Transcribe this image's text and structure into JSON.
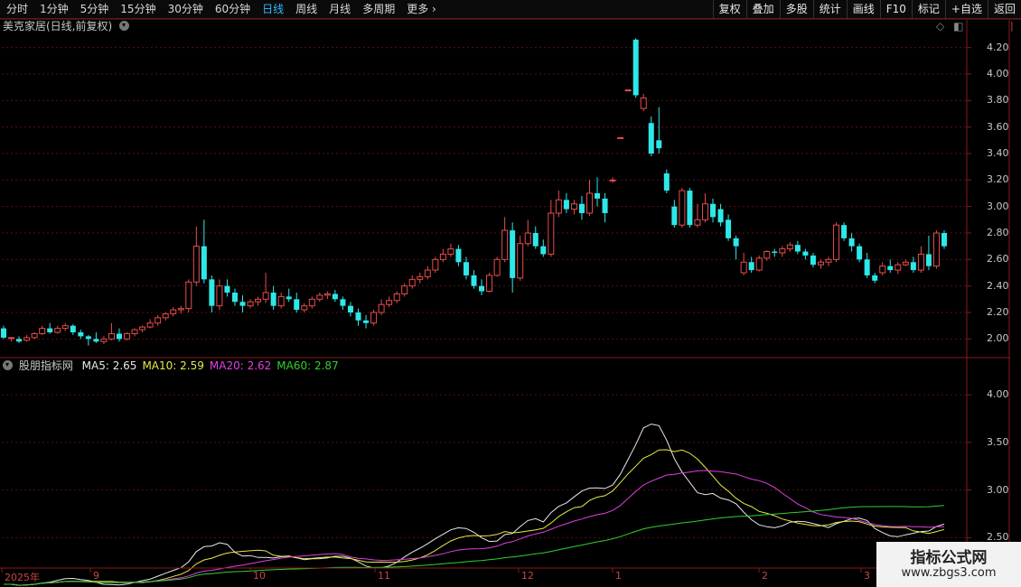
{
  "toolbar": {
    "periods": [
      "分时",
      "1分钟",
      "5分钟",
      "15分钟",
      "30分钟",
      "60分钟",
      "日线",
      "周线",
      "月线",
      "多周期",
      "更多"
    ],
    "active_period": "日线",
    "tools": [
      "复权",
      "叠加",
      "多股",
      "统计",
      "画线",
      "F10",
      "标记",
      "+自选",
      "返回"
    ]
  },
  "main_panel": {
    "title": "美克家居(日线,前复权)"
  },
  "indicator_panel": {
    "name": "股朋指标网",
    "items": [
      {
        "label": "MA5: 2.65",
        "color": "#e8e8e8"
      },
      {
        "label": "MA10: 2.59",
        "color": "#e8e848"
      },
      {
        "label": "MA20: 2.62",
        "color": "#e040e0"
      },
      {
        "label": "MA60: 2.87",
        "color": "#30d030"
      }
    ]
  },
  "price_axis": [
    "4.20",
    "4.00",
    "3.80",
    "3.60",
    "3.40",
    "3.20",
    "3.00",
    "2.80",
    "2.60",
    "2.40",
    "2.20",
    "2.00"
  ],
  "indicator_axis": [
    "4.00",
    "3.50",
    "3.00",
    "2.50"
  ],
  "date_axis": [
    "2025年",
    "9",
    "10",
    "11",
    "12",
    "1",
    "2",
    "3"
  ],
  "watermark": {
    "line1": "指标公式网",
    "line2": "www.zbgs3.com"
  },
  "colors": {
    "up": "#e84c4c",
    "down": "#2ee8e8",
    "grid": "#5a1010",
    "axis": "#8a1a1a"
  },
  "chart_data": {
    "type": "candlestick",
    "title": "美克家居(日线,前复权)",
    "ylim": [
      1.9,
      4.3
    ],
    "x_start": "2025年",
    "candles": [
      [
        2.08,
        2.1,
        2.01,
        2.0
      ],
      [
        2.01,
        2.0,
        2.01,
        1.98
      ],
      [
        2.0,
        2.02,
        1.98,
        1.97
      ],
      [
        1.99,
        2.03,
        2.01,
        1.98
      ],
      [
        2.01,
        2.05,
        2.04,
        2.0
      ],
      [
        2.04,
        2.1,
        2.08,
        2.03
      ],
      [
        2.08,
        2.12,
        2.05,
        2.04
      ],
      [
        2.05,
        2.1,
        2.08,
        2.04
      ],
      [
        2.08,
        2.12,
        2.1,
        2.06
      ],
      [
        2.1,
        2.11,
        2.05,
        2.03
      ],
      [
        2.05,
        2.07,
        2.02,
        2.0
      ],
      [
        2.02,
        2.03,
        2.0,
        1.95
      ],
      [
        2.0,
        2.05,
        1.98,
        1.97
      ],
      [
        1.98,
        2.02,
        2.0,
        1.96
      ],
      [
        2.0,
        2.12,
        2.04,
        1.99
      ],
      [
        2.04,
        2.08,
        2.0,
        1.98
      ],
      [
        2.0,
        2.05,
        2.04,
        1.99
      ],
      [
        2.04,
        2.08,
        2.07,
        2.02
      ],
      [
        2.07,
        2.1,
        2.09,
        2.05
      ],
      [
        2.09,
        2.15,
        2.12,
        2.08
      ],
      [
        2.12,
        2.18,
        2.16,
        2.1
      ],
      [
        2.16,
        2.2,
        2.19,
        2.14
      ],
      [
        2.19,
        2.24,
        2.22,
        2.17
      ],
      [
        2.22,
        2.25,
        2.23,
        2.19
      ],
      [
        2.23,
        2.45,
        2.43,
        2.2
      ],
      [
        2.43,
        2.85,
        2.7,
        2.4
      ],
      [
        2.7,
        2.9,
        2.45,
        2.42
      ],
      [
        2.45,
        2.48,
        2.25,
        2.2
      ],
      [
        2.25,
        2.45,
        2.4,
        2.22
      ],
      [
        2.4,
        2.45,
        2.35,
        2.32
      ],
      [
        2.35,
        2.38,
        2.28,
        2.25
      ],
      [
        2.28,
        2.33,
        2.25,
        2.2
      ],
      [
        2.25,
        2.3,
        2.28,
        2.23
      ],
      [
        2.28,
        2.32,
        2.3,
        2.25
      ],
      [
        2.3,
        2.5,
        2.35,
        2.27
      ],
      [
        2.35,
        2.4,
        2.25,
        2.22
      ],
      [
        2.25,
        2.35,
        2.32,
        2.23
      ],
      [
        2.32,
        2.38,
        2.3,
        2.28
      ],
      [
        2.3,
        2.35,
        2.22,
        2.2
      ],
      [
        2.22,
        2.27,
        2.25,
        2.2
      ],
      [
        2.25,
        2.32,
        2.3,
        2.23
      ],
      [
        2.3,
        2.35,
        2.33,
        2.28
      ],
      [
        2.33,
        2.36,
        2.34,
        2.3
      ],
      [
        2.34,
        2.37,
        2.3,
        2.28
      ],
      [
        2.3,
        2.32,
        2.25,
        2.22
      ],
      [
        2.25,
        2.28,
        2.2,
        2.17
      ],
      [
        2.2,
        2.23,
        2.14,
        2.1
      ],
      [
        2.14,
        2.18,
        2.12,
        2.08
      ],
      [
        2.12,
        2.22,
        2.2,
        2.1
      ],
      [
        2.2,
        2.3,
        2.26,
        2.18
      ],
      [
        2.26,
        2.32,
        2.29,
        2.24
      ],
      [
        2.29,
        2.36,
        2.34,
        2.27
      ],
      [
        2.34,
        2.42,
        2.4,
        2.32
      ],
      [
        2.4,
        2.48,
        2.45,
        2.38
      ],
      [
        2.45,
        2.5,
        2.47,
        2.42
      ],
      [
        2.47,
        2.55,
        2.52,
        2.45
      ],
      [
        2.52,
        2.62,
        2.6,
        2.5
      ],
      [
        2.6,
        2.68,
        2.64,
        2.58
      ],
      [
        2.64,
        2.72,
        2.68,
        2.62
      ],
      [
        2.68,
        2.71,
        2.58,
        2.55
      ],
      [
        2.58,
        2.62,
        2.48,
        2.45
      ],
      [
        2.48,
        2.52,
        2.4,
        2.38
      ],
      [
        2.4,
        2.45,
        2.36,
        2.33
      ],
      [
        2.36,
        2.5,
        2.48,
        2.35
      ],
      [
        2.48,
        2.62,
        2.6,
        2.47
      ],
      [
        2.6,
        2.92,
        2.82,
        2.58
      ],
      [
        2.82,
        2.88,
        2.46,
        2.35
      ],
      [
        2.46,
        2.78,
        2.72,
        2.44
      ],
      [
        2.72,
        2.9,
        2.8,
        2.7
      ],
      [
        2.8,
        2.85,
        2.7,
        2.68
      ],
      [
        2.7,
        2.75,
        2.64,
        2.62
      ],
      [
        2.64,
        3.05,
        2.95,
        2.62
      ],
      [
        2.95,
        3.12,
        3.05,
        2.92
      ],
      [
        3.05,
        3.1,
        2.98,
        2.95
      ],
      [
        2.98,
        3.05,
        3.02,
        2.94
      ],
      [
        3.02,
        3.08,
        2.95,
        2.9
      ],
      [
        2.95,
        3.2,
        3.1,
        2.93
      ],
      [
        3.1,
        3.22,
        3.06,
        3.0
      ],
      [
        3.06,
        3.1,
        2.95,
        2.88
      ],
      [
        3.2,
        3.22,
        3.2,
        3.18
      ],
      [
        3.52,
        3.52,
        3.52,
        3.52
      ],
      [
        3.88,
        3.88,
        3.88,
        3.88
      ],
      [
        4.26,
        4.27,
        3.84,
        3.82
      ],
      [
        3.74,
        3.85,
        3.82,
        3.72
      ],
      [
        3.63,
        3.68,
        3.4,
        3.38
      ],
      [
        3.5,
        3.75,
        3.44,
        3.4
      ],
      [
        3.25,
        3.28,
        3.12,
        3.1
      ],
      [
        3.0,
        3.05,
        2.86,
        2.84
      ],
      [
        2.86,
        3.14,
        3.12,
        2.84
      ],
      [
        3.12,
        3.14,
        2.86,
        2.84
      ],
      [
        2.86,
        3.02,
        2.9,
        2.84
      ],
      [
        2.9,
        3.1,
        3.02,
        2.88
      ],
      [
        3.02,
        3.06,
        2.92,
        2.88
      ],
      [
        2.98,
        3.02,
        2.88,
        2.85
      ],
      [
        2.9,
        2.94,
        2.76,
        2.74
      ],
      [
        2.76,
        2.78,
        2.7,
        2.6
      ],
      [
        2.5,
        2.65,
        2.58,
        2.48
      ],
      [
        2.58,
        2.62,
        2.52,
        2.5
      ],
      [
        2.52,
        2.63,
        2.61,
        2.51
      ],
      [
        2.61,
        2.67,
        2.66,
        2.59
      ],
      [
        2.66,
        2.68,
        2.65,
        2.62
      ],
      [
        2.65,
        2.7,
        2.68,
        2.62
      ],
      [
        2.68,
        2.73,
        2.71,
        2.66
      ],
      [
        2.71,
        2.74,
        2.66,
        2.64
      ],
      [
        2.66,
        2.68,
        2.63,
        2.6
      ],
      [
        2.63,
        2.65,
        2.56,
        2.54
      ],
      [
        2.56,
        2.6,
        2.58,
        2.53
      ],
      [
        2.58,
        2.62,
        2.6,
        2.55
      ],
      [
        2.6,
        2.88,
        2.86,
        2.58
      ],
      [
        2.86,
        2.88,
        2.76,
        2.74
      ],
      [
        2.76,
        2.8,
        2.7,
        2.66
      ],
      [
        2.7,
        2.72,
        2.6,
        2.58
      ],
      [
        2.6,
        2.65,
        2.48,
        2.46
      ],
      [
        2.48,
        2.5,
        2.44,
        2.42
      ],
      [
        2.5,
        2.58,
        2.55,
        2.48
      ],
      [
        2.55,
        2.6,
        2.52,
        2.5
      ],
      [
        2.52,
        2.58,
        2.56,
        2.49
      ],
      [
        2.56,
        2.6,
        2.58,
        2.55
      ],
      [
        2.58,
        2.62,
        2.52,
        2.5
      ],
      [
        2.52,
        2.7,
        2.64,
        2.5
      ],
      [
        2.64,
        2.78,
        2.55,
        2.52
      ],
      [
        2.55,
        2.82,
        2.8,
        2.53
      ],
      [
        2.8,
        2.82,
        2.7,
        2.68
      ]
    ]
  }
}
